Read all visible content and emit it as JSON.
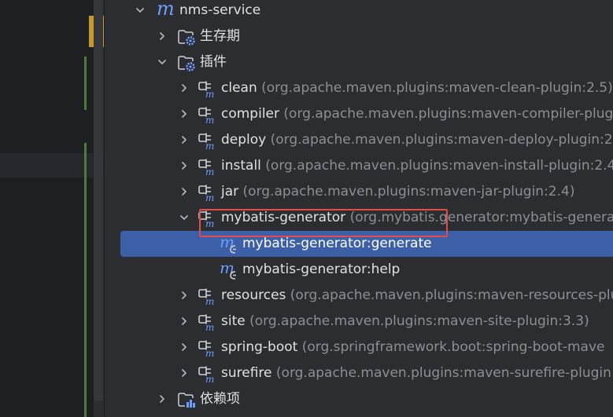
{
  "module": {
    "name": "nms-service",
    "logo": "m"
  },
  "lifecycle": {
    "label": "生存期"
  },
  "plugins_folder": {
    "label": "插件"
  },
  "plugins": [
    {
      "name": "clean",
      "coord": "(org.apache.maven.plugins:maven-clean-plugin:2.5)"
    },
    {
      "name": "compiler",
      "coord": "(org.apache.maven.plugins:maven-compiler-plugin:"
    },
    {
      "name": "deploy",
      "coord": "(org.apache.maven.plugins:maven-deploy-plugin:2"
    },
    {
      "name": "install",
      "coord": "(org.apache.maven.plugins:maven-install-plugin:2.4"
    },
    {
      "name": "jar",
      "coord": "(org.apache.maven.plugins:maven-jar-plugin:2.4)"
    },
    {
      "name": "mybatis-generator",
      "coord": "(org.mybatis.generator:mybatis-genera"
    },
    {
      "name": "resources",
      "coord": "(org.apache.maven.plugins:maven-resources-plu"
    },
    {
      "name": "site",
      "coord": "(org.apache.maven.plugins:maven-site-plugin:3.3)"
    },
    {
      "name": "spring-boot",
      "coord": "(org.springframework.boot:spring-boot-mave"
    },
    {
      "name": "surefire",
      "coord": "(org.apache.maven.plugins:maven-surefire-plugin"
    }
  ],
  "goals": [
    {
      "label": "mybatis-generator:generate",
      "selected": true
    },
    {
      "label": "mybatis-generator:help",
      "selected": false
    }
  ],
  "dependencies": {
    "label": "依赖项"
  },
  "colors": {
    "selection": "#3d5fa8",
    "highlight_box": "#e04b4b",
    "maven_blue": "#6d9eff"
  }
}
